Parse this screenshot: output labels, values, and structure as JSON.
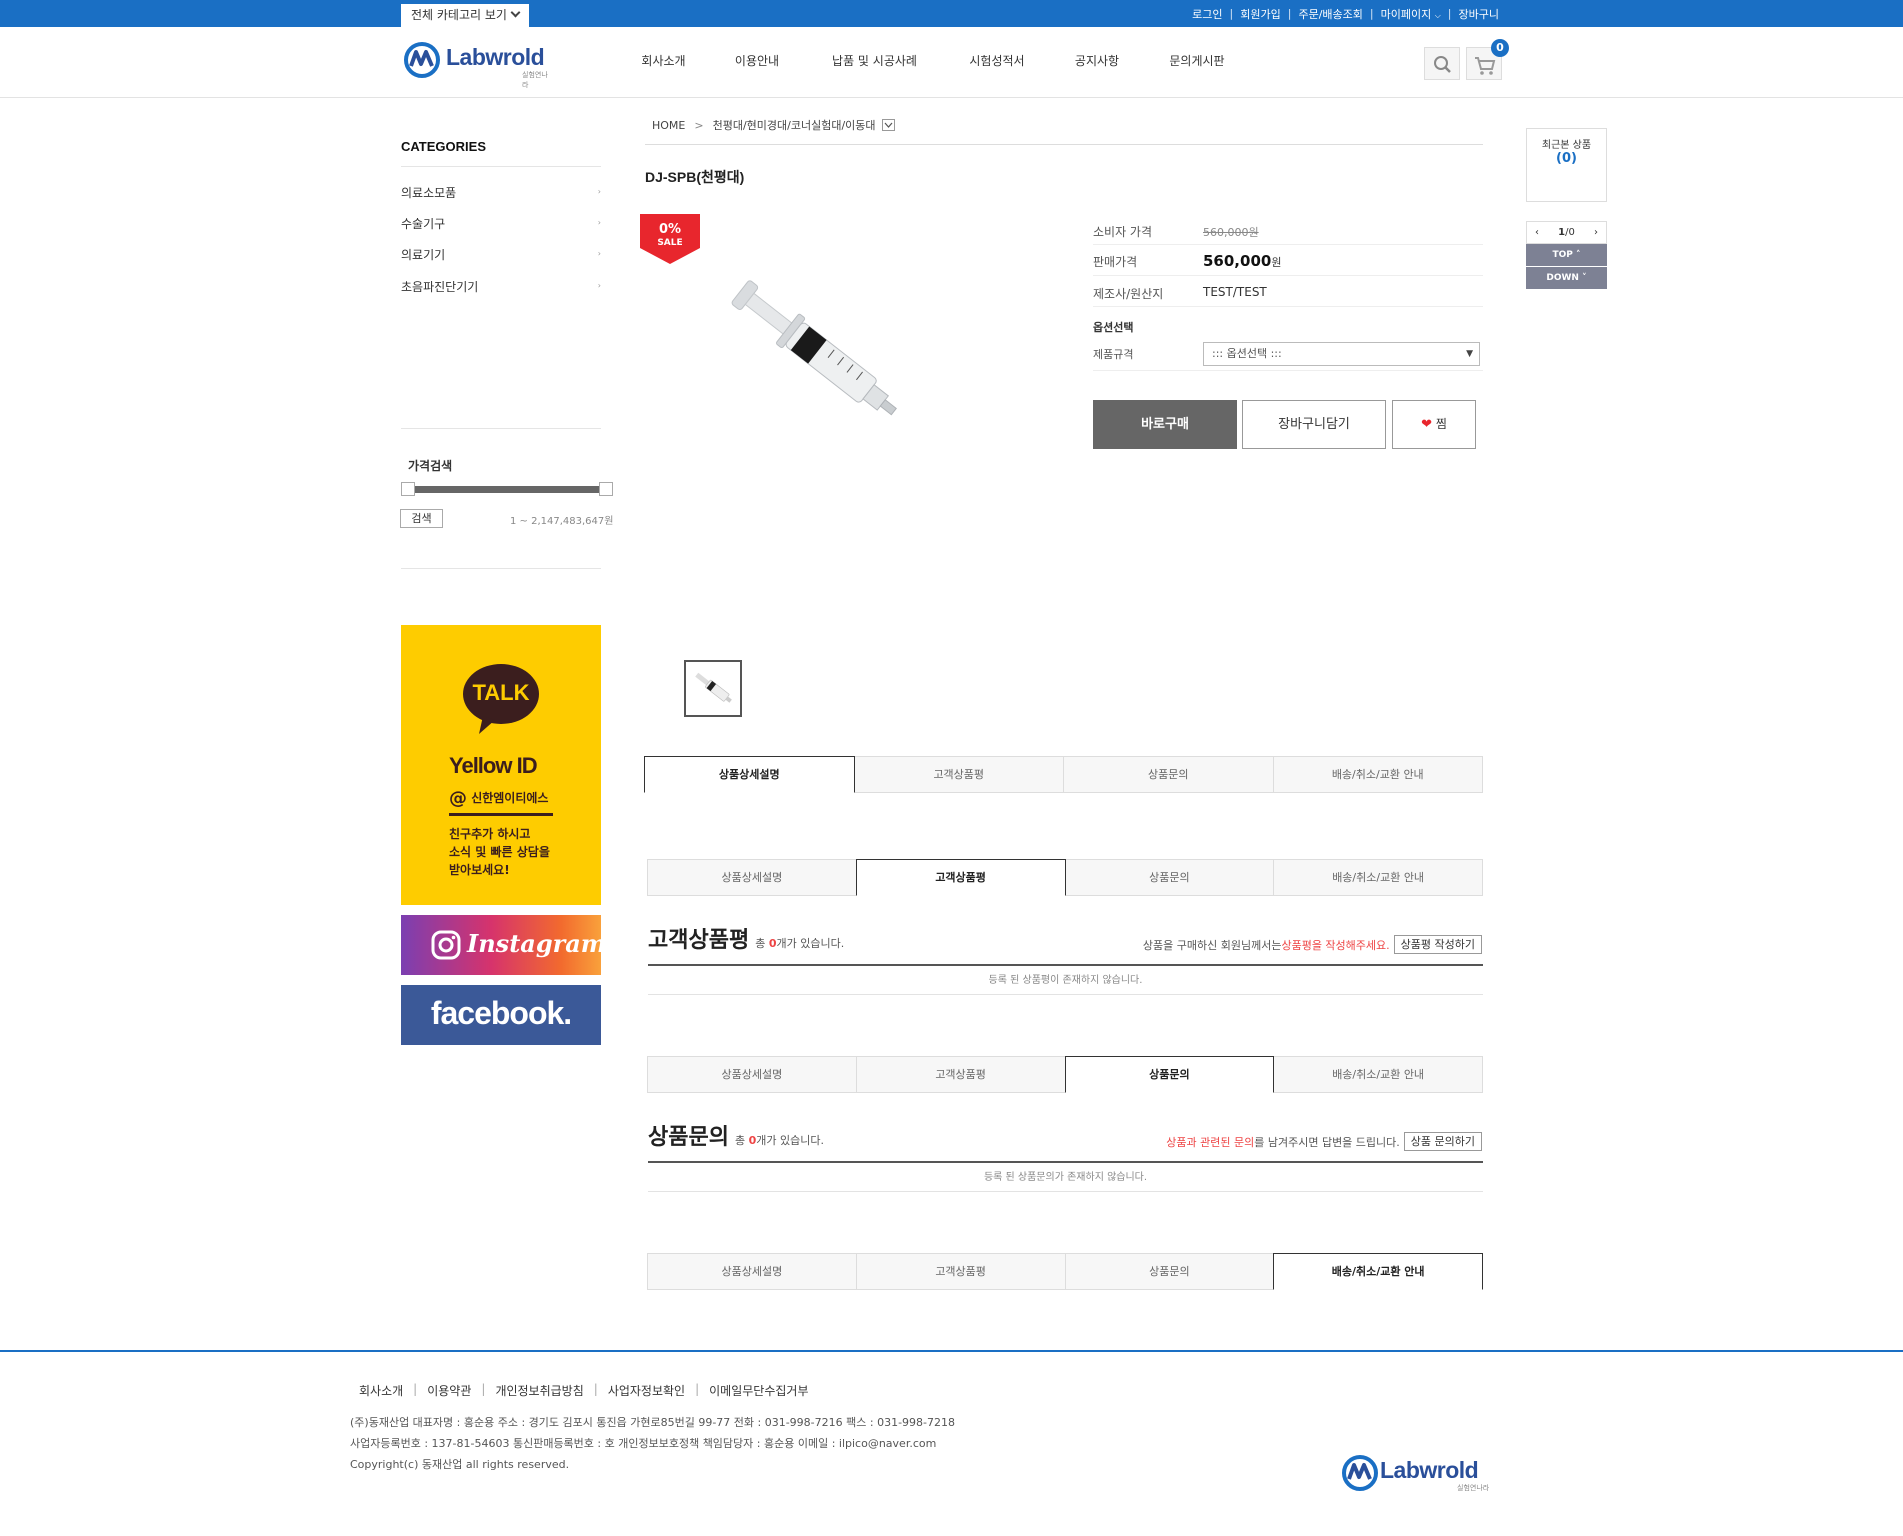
{
  "topbar": {
    "category_button": "전체 카테고리 보기",
    "links": [
      "로그인",
      "회원가입",
      "주문/배송조회",
      "마이페이지",
      "장바구니"
    ]
  },
  "header": {
    "logo_text": "Labwrold",
    "logo_sub": "실험연나라",
    "nav": [
      "회사소개",
      "이용안내",
      "납품 및 시공사례",
      "시험성적서",
      "공지사항",
      "문의게시판"
    ],
    "cart_count": "0"
  },
  "sidebar": {
    "categories_title": "CATEGORIES",
    "categories": [
      "의료소모품",
      "수술기구",
      "의료기기",
      "초음파진단기기"
    ],
    "price_search_title": "가격검색",
    "search_button": "검색",
    "price_range": "1 ~ 2,147,483,647원",
    "kakao": {
      "talk": "TALK",
      "yellow_id": "Yellow ID",
      "account": "신한엠이티에스",
      "line1": "친구추가 하시고",
      "line2": "소식 및 빠른 상담을",
      "line3": "받아보세요!"
    },
    "instagram": "Instagram",
    "facebook": "facebook."
  },
  "breadcrumb": {
    "home": "HOME",
    "current": "천평대/현미경대/코너실험대/이동대"
  },
  "product": {
    "title": "DJ-SPB(천평대)",
    "sale_badge_pct": "0%",
    "sale_badge_text": "SALE",
    "consumer_price_label": "소비자 가격",
    "consumer_price": "560,000원",
    "sale_price_label": "판매가격",
    "sale_price": "560,000",
    "sale_price_unit": "원",
    "maker_label": "제조사/원산지",
    "maker": "TEST/TEST",
    "option_title": "옵션선택",
    "option_label": "제품규격",
    "option_placeholder": "::: 옵션선택 :::",
    "buy_now": "바로구매",
    "add_cart": "장바구니담기",
    "wish": "찜"
  },
  "tabs": [
    "상품상세설명",
    "고객상품평",
    "상품문의",
    "배송/취소/교환 안내"
  ],
  "review": {
    "title": "고객상품평",
    "count_prefix": "총 ",
    "count": "0",
    "count_suffix": "개가 있습니다.",
    "notice_before": "상품을 구매하신 회원님께서는 ",
    "notice_red": "상품평을 작성해주세요.",
    "write_button": "상품평 작성하기",
    "empty": "등록 된 상품평이 존재하지 않습니다."
  },
  "qna": {
    "title": "상품문의",
    "count_prefix": "총 ",
    "count": "0",
    "count_suffix": "개가 있습니다.",
    "notice_red": "상품과 관련된 문의",
    "notice_after": "를 남겨주시면 답변을 드립니다.",
    "write_button": "상품 문의하기",
    "empty": "등록 된 상품문의가 존재하지 않습니다."
  },
  "right_widget": {
    "recent_title": "최근본 상품",
    "recent_count": "(0)",
    "pager_current": "1",
    "pager_total": "/0",
    "top": "TOP",
    "down": "DOWN"
  },
  "footer": {
    "links": [
      "회사소개",
      "이용약관",
      "개인정보취급방침",
      "사업자정보확인",
      "이메일무단수집거부"
    ],
    "line1": "(주)동재산업   대표자명 : 홍순용       주소 : 경기도 김포시 통진읍 가현로85번길 99-77    전화 : 031-998-7216    팩스 : 031-998-7218",
    "line2": "사업자등록번호 : 137-81-54603     통신판매등록번호 : 호     개인정보보호정책 책임담당자 : 홍순용   이메일 : ilpico@naver.com",
    "line3": "Copyright(c) 동재산업 all rights reserved."
  },
  "colors": {
    "brand_blue": "#1a6fc4",
    "sale_red": "#e8262d",
    "kakao_yellow": "#fecc00",
    "facebook_blue": "#3b5998"
  }
}
